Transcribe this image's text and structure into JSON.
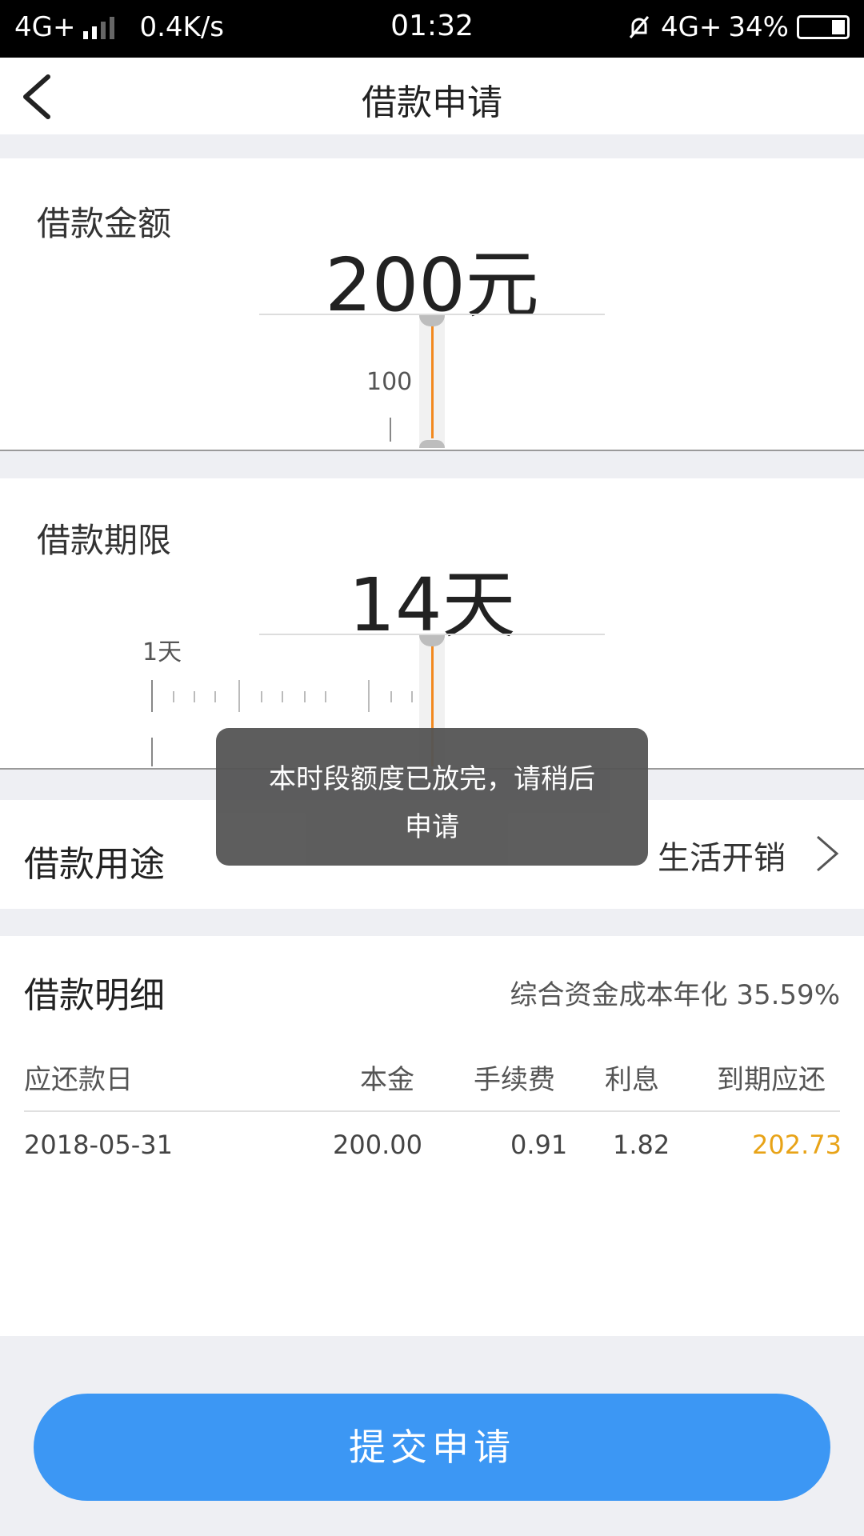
{
  "status_bar": {
    "network_left": "4G+",
    "speed": "0.4K/s",
    "time": "01:32",
    "network_right": "4G+",
    "battery": "34%"
  },
  "header": {
    "title": "借款申请",
    "back_icon": "chevron-left-icon"
  },
  "amount": {
    "label": "借款金额",
    "value": "200元",
    "tick_label": "100"
  },
  "term": {
    "label": "借款期限",
    "value": "14天",
    "tick_label": "1天"
  },
  "toast": {
    "text": "本时段额度已放完，请稍后申请"
  },
  "purpose": {
    "label": "借款用途",
    "value": "生活开销"
  },
  "details": {
    "title": "借款明细",
    "annual_rate_label": "综合资金成本年化 35.59%",
    "headers": [
      "应还款日",
      "本金",
      "手续费",
      "利息",
      "到期应还"
    ],
    "rows": [
      [
        "2018-05-31",
        "200.00",
        "0.91",
        "1.82",
        "202.73"
      ]
    ]
  },
  "submit": {
    "label": "提交申请"
  },
  "colors": {
    "accent": "#3c97f4",
    "highlight": "#e8a317",
    "slider": "#f2891f"
  }
}
